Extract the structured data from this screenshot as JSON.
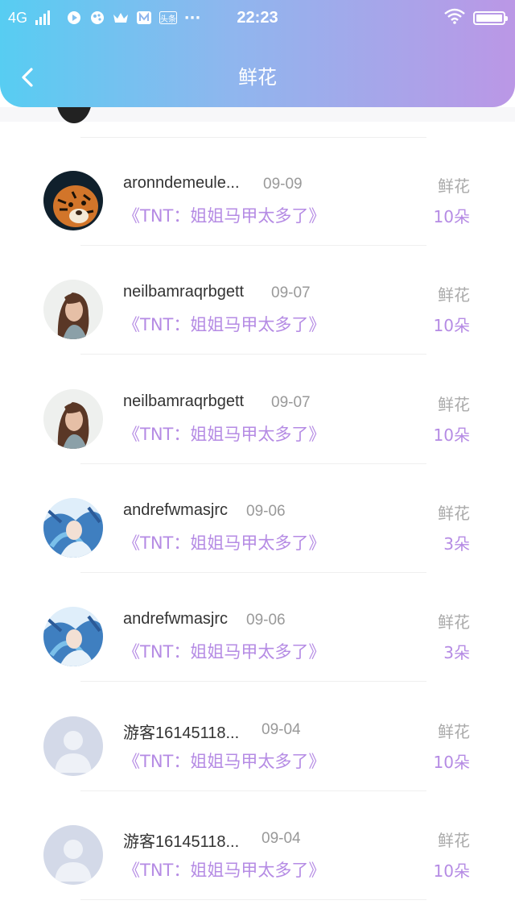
{
  "status_bar": {
    "network": "4G",
    "time": "22:23",
    "more": "···",
    "icons": [
      "play-circle-icon",
      "paint-icon",
      "crown-icon",
      "video-icon",
      "news-icon"
    ],
    "app_label": "头条",
    "battery_level": 1.0
  },
  "header": {
    "title": "鲜花",
    "back_icon": "chevron-left-icon"
  },
  "colors": {
    "header_gradient_start": "#57cdf2",
    "header_gradient_end": "#bb97e6",
    "accent": "#b58be4",
    "name_text": "#333333",
    "muted_text": "#999999"
  },
  "items": [
    {
      "name": "aronndemeule...",
      "date": "09-09",
      "work": "《TNT：姐姐马甲太多了》",
      "gift": "鲜花",
      "count": "10朵",
      "avatar": "tiger-avatar"
    },
    {
      "name": "neilbamraqrbgett",
      "date": "09-07",
      "work": "《TNT：姐姐马甲太多了》",
      "gift": "鲜花",
      "count": "10朵",
      "avatar": "woman-avatar"
    },
    {
      "name": "neilbamraqrbgett",
      "date": "09-07",
      "work": "《TNT：姐姐马甲太多了》",
      "gift": "鲜花",
      "count": "10朵",
      "avatar": "woman-avatar"
    },
    {
      "name": "andrefwmasjrc",
      "date": "09-06",
      "work": "《TNT：姐姐马甲太多了》",
      "gift": "鲜花",
      "count": "3朵",
      "avatar": "anime-avatar"
    },
    {
      "name": "andrefwmasjrc",
      "date": "09-06",
      "work": "《TNT：姐姐马甲太多了》",
      "gift": "鲜花",
      "count": "3朵",
      "avatar": "anime-avatar"
    },
    {
      "name": "游客16145118...",
      "date": "09-04",
      "work": "《TNT：姐姐马甲太多了》",
      "gift": "鲜花",
      "count": "10朵",
      "avatar": "default-avatar"
    },
    {
      "name": "游客16145118...",
      "date": "09-04",
      "work": "《TNT：姐姐马甲太多了》",
      "gift": "鲜花",
      "count": "10朵",
      "avatar": "default-avatar"
    }
  ]
}
